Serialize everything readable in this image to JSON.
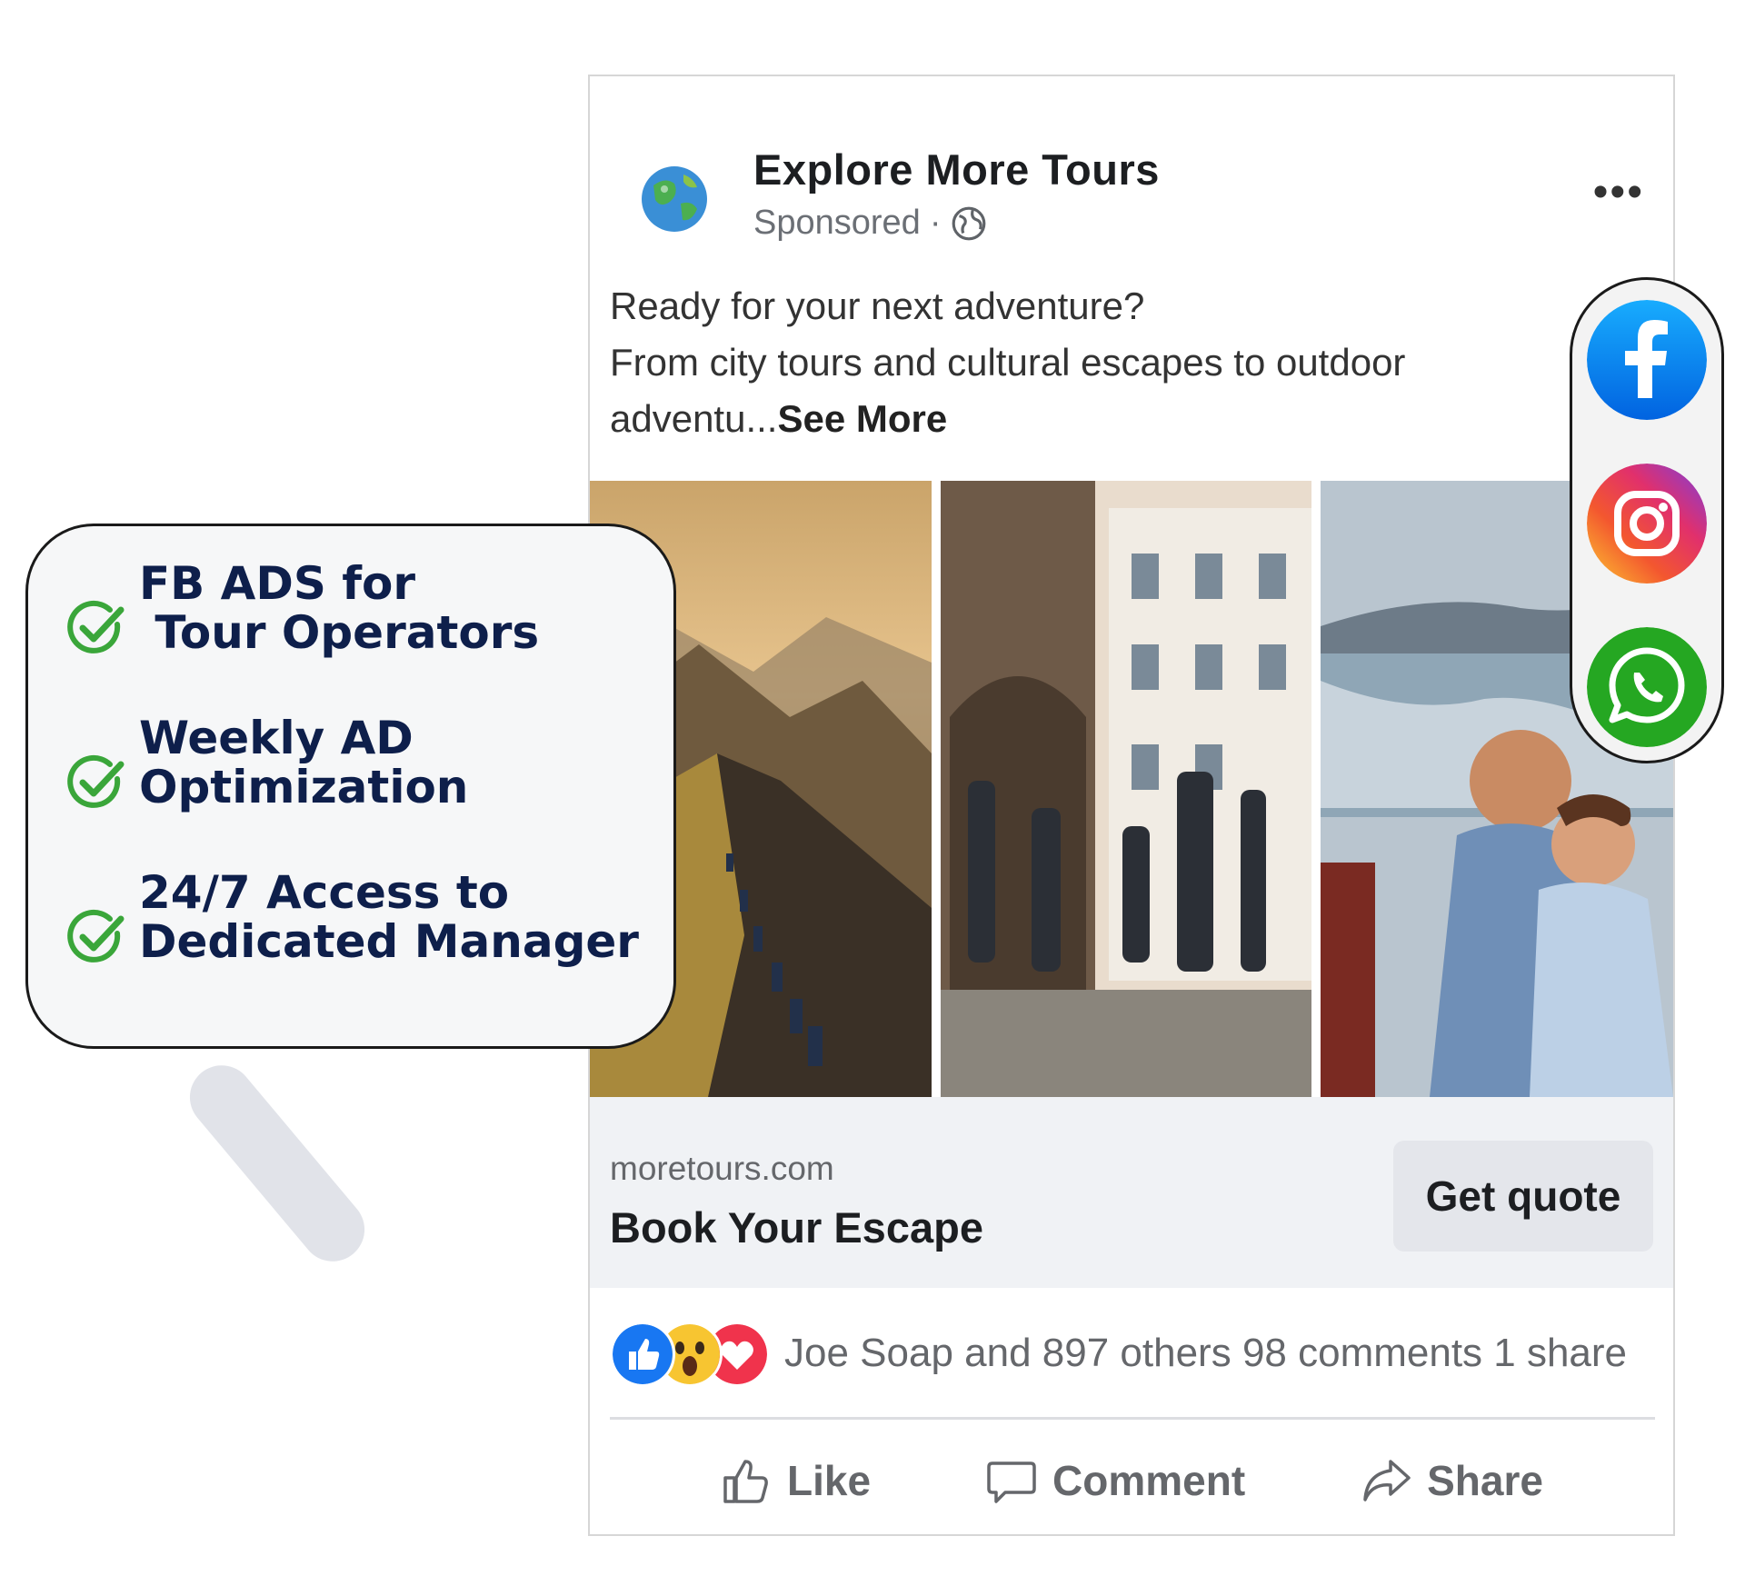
{
  "post": {
    "page_name": "Explore More Tours",
    "sponsored_label": "Sponsored",
    "more_label": "•••",
    "text_line1": "Ready for your next adventure?",
    "text_line2": "From city tours and cultural escapes to outdoor",
    "text_line3": "adventu...",
    "see_more": "See More",
    "link": {
      "domain": "moretours.com",
      "headline": "Book Your Escape",
      "cta": "Get quote"
    },
    "reactions_summary": "Joe Soap and 897 others 98 comments 1 share",
    "actions": {
      "like": "Like",
      "comment": "Comment",
      "share": "Share"
    }
  },
  "features": [
    {
      "line1": "FB ADS for",
      "line2": " Tour Operators"
    },
    {
      "line1": "Weekly AD",
      "line2": "Optimization"
    },
    {
      "line1": "24/7 Access to",
      "line2": "Dedicated Manager"
    }
  ],
  "social": [
    "facebook-icon",
    "instagram-icon",
    "whatsapp-icon"
  ],
  "colors": {
    "feature_text": "#0e1f4b",
    "check_green": "#3aa63a",
    "facebook_blue": "#1877f2",
    "whatsapp_green": "#25a722"
  }
}
